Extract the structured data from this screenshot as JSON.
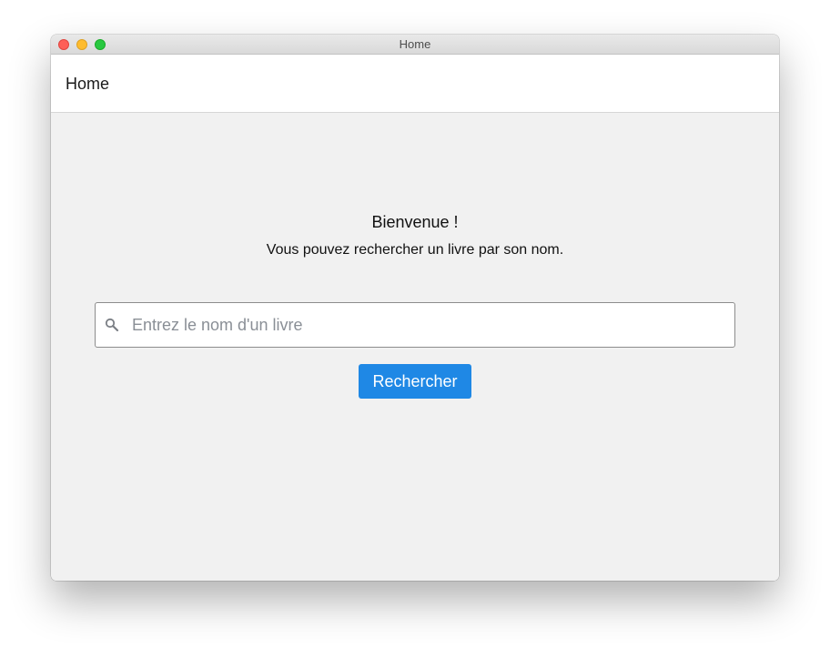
{
  "window": {
    "title": "Home"
  },
  "appbar": {
    "title": "Home"
  },
  "main": {
    "welcome": "Bienvenue !",
    "subtitle": "Vous pouvez rechercher un livre par son nom.",
    "search": {
      "placeholder": "Entrez le nom d'un livre",
      "value": "",
      "icon": "search-icon"
    },
    "search_button_label": "Rechercher"
  },
  "colors": {
    "accent": "#1f88e5",
    "background": "#f1f1f1",
    "appbar": "#ffffff",
    "traffic_close": "#fe5f57",
    "traffic_minimize": "#febc2e",
    "traffic_zoom": "#28c840"
  }
}
